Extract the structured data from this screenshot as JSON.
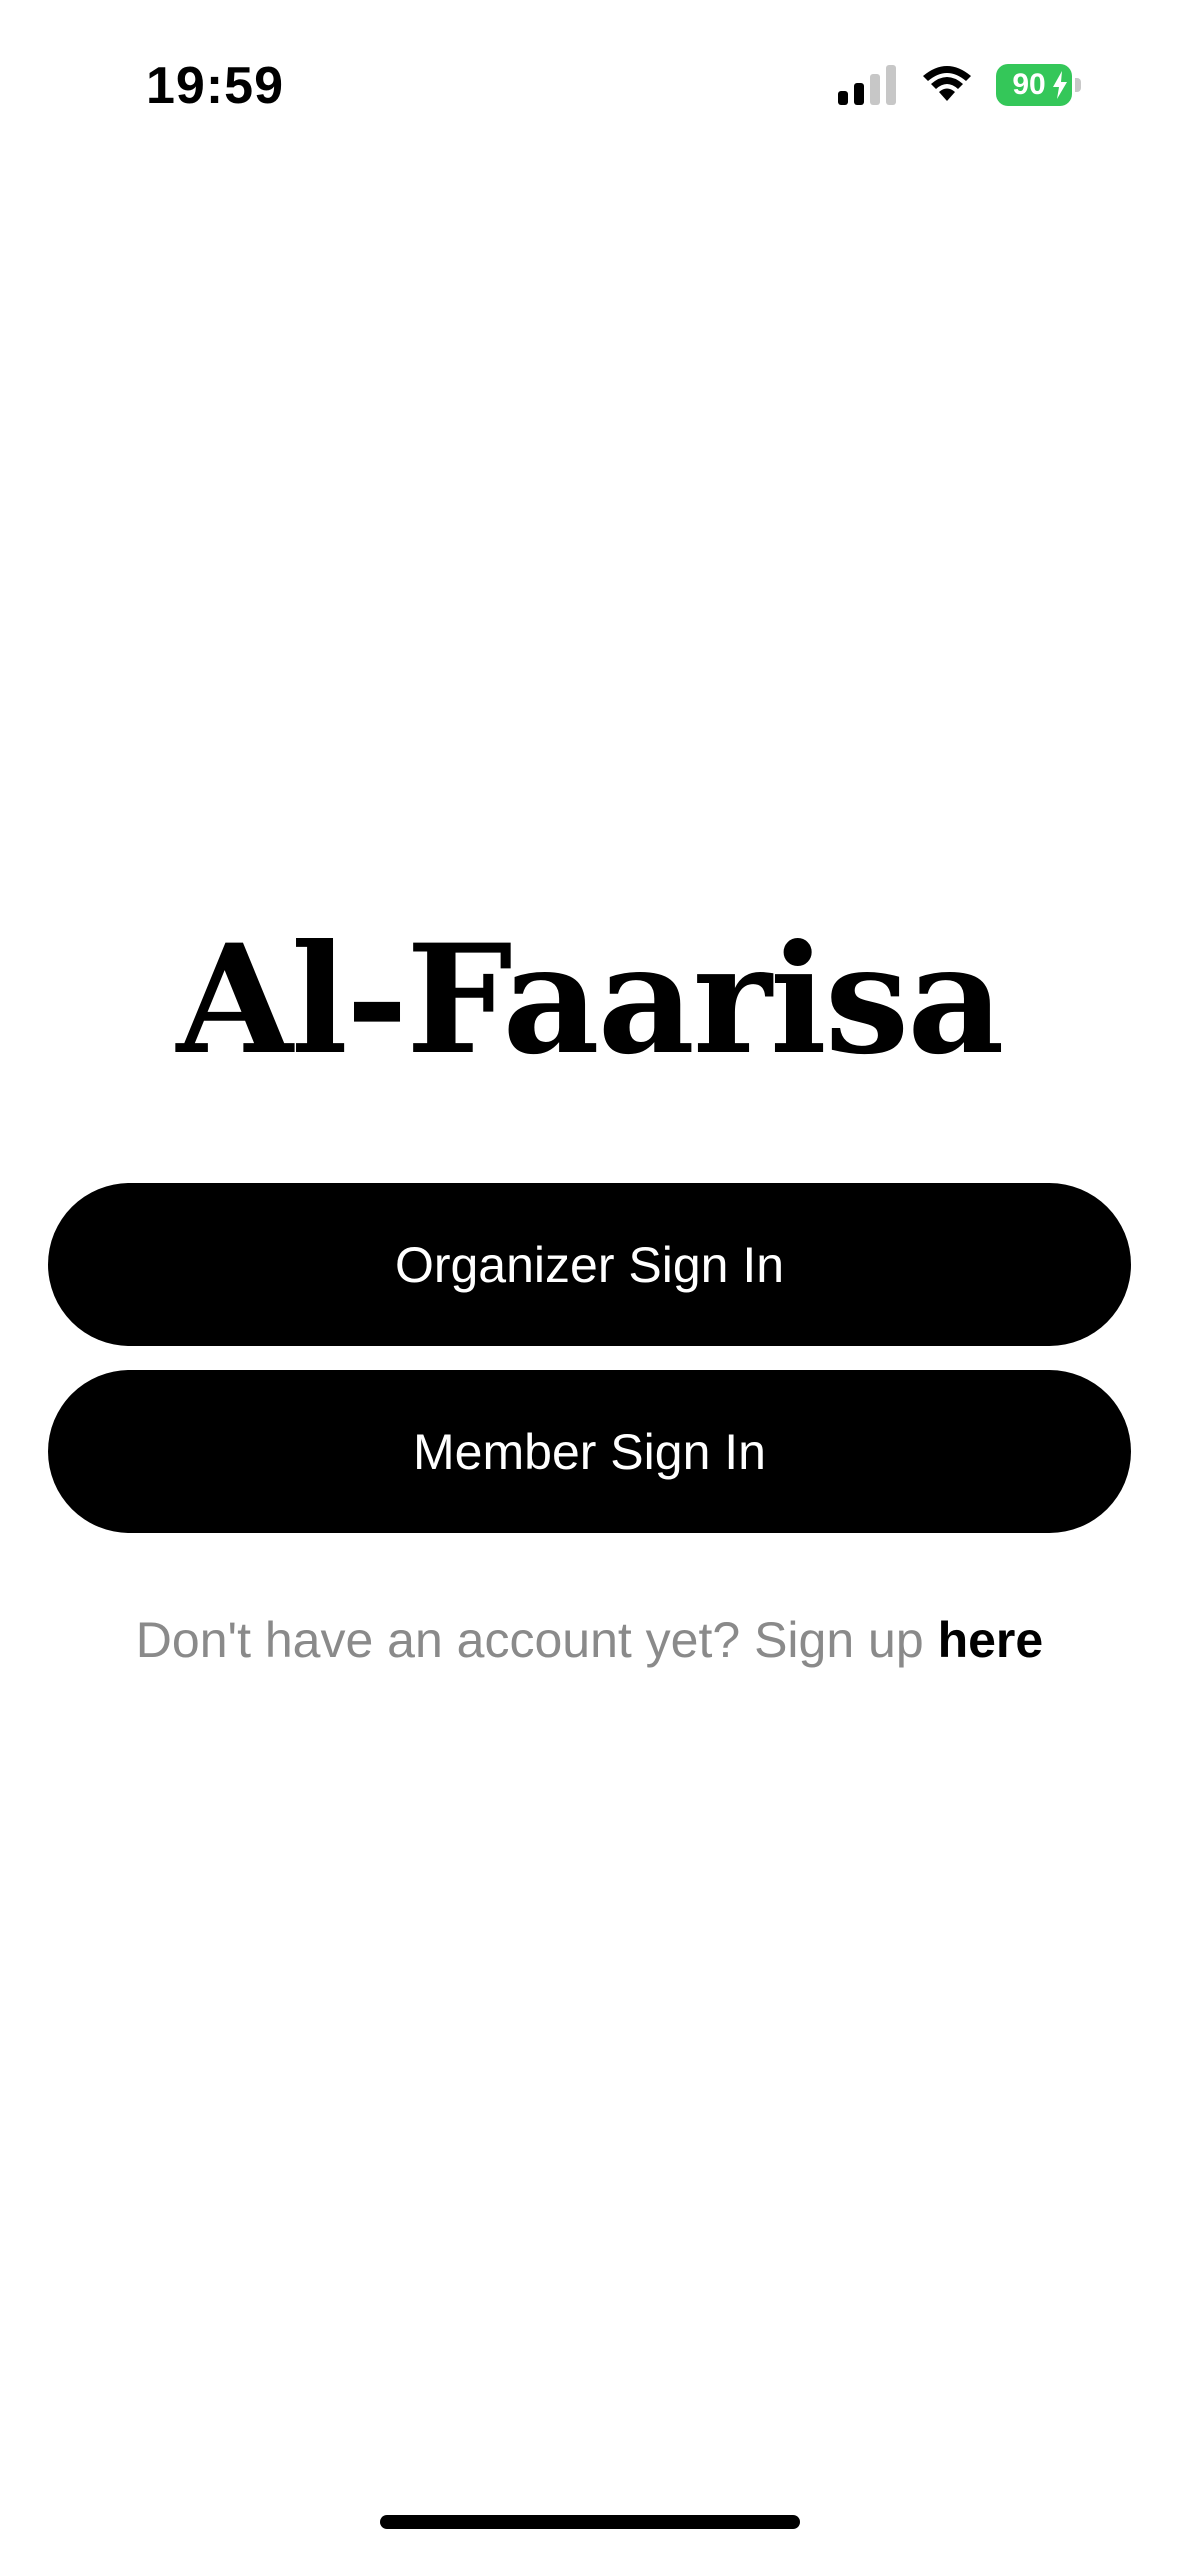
{
  "status_bar": {
    "time": "19:59",
    "battery_level": "90",
    "battery_color": "#34c759",
    "icons": [
      "cellular-signal-icon",
      "wifi-icon",
      "battery-charging-icon"
    ]
  },
  "app": {
    "title": "Al-Faarisa"
  },
  "buttons": {
    "organizer_label": "Organizer Sign In",
    "member_label": "Member Sign In",
    "background_color": "#000000",
    "text_color": "#ffffff"
  },
  "signup": {
    "prompt": "Don't have an account yet? Sign up",
    "link_label": "here"
  }
}
